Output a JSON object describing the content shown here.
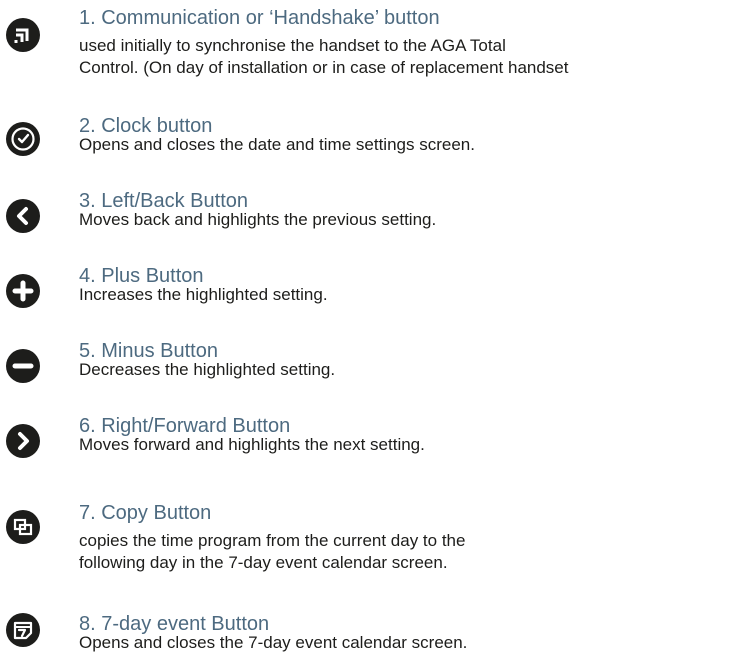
{
  "items": [
    {
      "icon": "handshake-icon",
      "title": "1. Communication or ‘Handshake’ button",
      "desc_lines": [
        "used initially to synchronise the handset to the AGA Total",
        "Control. (On day of installation or in case of replacement handset"
      ]
    },
    {
      "icon": "clock-icon",
      "title": "2. Clock button",
      "desc_lines": [
        "Opens and closes the date and time settings screen."
      ]
    },
    {
      "icon": "chevron-left-icon",
      "title": "3. Left/Back Button",
      "desc_lines": [
        "Moves back and highlights the previous setting."
      ]
    },
    {
      "icon": "plus-icon",
      "title": "4. Plus Button",
      "desc_lines": [
        "Increases the highlighted setting."
      ]
    },
    {
      "icon": "minus-icon",
      "title": "5. Minus Button",
      "desc_lines": [
        "Decreases the highlighted setting."
      ]
    },
    {
      "icon": "chevron-right-icon",
      "title": "6. Right/Forward Button",
      "desc_lines": [
        "Moves forward and highlights the next setting."
      ]
    },
    {
      "icon": "copy-icon",
      "title": "7. Copy Button",
      "desc_lines": [
        "copies the time program from the current day to the",
        "following day in the 7-day event calendar screen."
      ]
    },
    {
      "icon": "calendar-7-icon",
      "title": "8. 7-day event Button",
      "desc_lines": [
        "Opens and closes the 7-day event calendar screen."
      ]
    }
  ]
}
